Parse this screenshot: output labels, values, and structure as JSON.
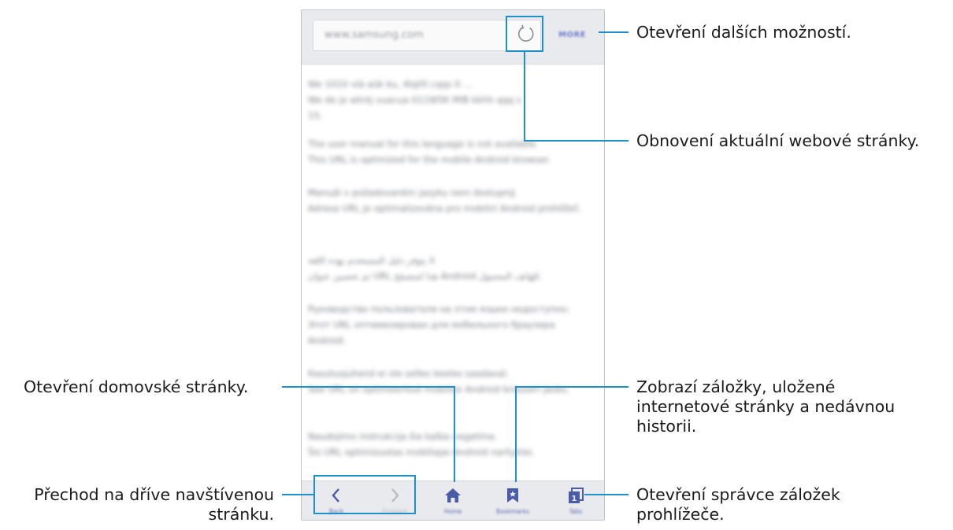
{
  "browser": {
    "url": "www.samsung.com",
    "more_label": "MORE",
    "content_paragraphs": [
      "We 1010 vlá aŭk ku, 4lqiñl cqqs 0 ...\nWe de je wtntj vuacua 011W5K MlB kkhh qqq s\n15.",
      "The user manual for this language is not available.\nThis URL is optimized for the mobile Android browser.",
      "Manuál v požadovaném jazyku není dostupný.\nAdresa URL je optimalizována pro mobilní Android prohlížeč.",
      "لا يتوفر دليل المستخدم بهذه اللغة.\nتم تحسين عنوان URL هذا لمتصفح Android للهاتف المحمول.",
      "Руководство пользователя на этом языке недоступно.\nЭтот URL оптимизирован для мобильного браузера Android.",
      "Kasutusjuhend ei ole selles keeles saadaval.\nSee URL on optimeeritud mobiilse Android brauseri jaoks.",
      "Naudojimo instrukcija šia kalba negalima.\nŠis URL optimizuotas mobiliajai Android naršyklei."
    ],
    "nav": {
      "back_label": "Back",
      "forward_label": "Forward",
      "home_label": "Home",
      "bookmarks_label": "Bookmarks",
      "tabs_label": "Tabs",
      "tabs_count": "1"
    }
  },
  "callouts": {
    "more": "Otevření dalších možností.",
    "refresh": "Obnovení aktuální webové stránky.",
    "home": "Otevření domovské stránky.",
    "bookmarks": "Zobrazí záložky, uložené\ninternetové stránky a nedávnou\nhistorii.",
    "back_forward": "Přechod na dříve navštívenou\nstránku.",
    "tabs": "Otevření správce záložek\nprohlížeče."
  },
  "colors": {
    "accent_line": "#1f8fc9",
    "nav_icon": "#5b6ab8",
    "toolbar_bg": "#e9eaee"
  }
}
